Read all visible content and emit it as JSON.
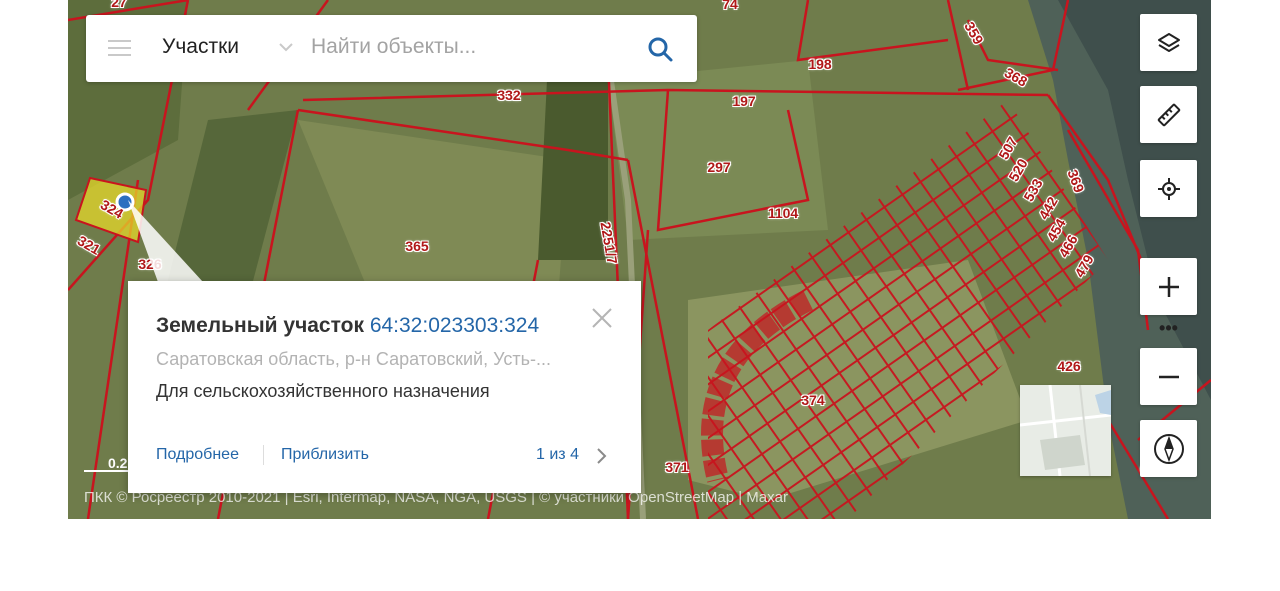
{
  "search": {
    "menu_icon": "hamburger-icon",
    "layer_label": "Участки",
    "placeholder": "Найти объекты...",
    "search_icon": "search-icon"
  },
  "map": {
    "parcel_labels": [
      "27",
      "74",
      "359",
      "198",
      "368",
      "332",
      "197",
      "507",
      "520",
      "297",
      "369",
      "533",
      "442",
      "1104",
      "454",
      "466",
      "2251/7",
      "479",
      "365",
      "321",
      "324",
      "326",
      "426",
      "374",
      "371",
      "67"
    ],
    "scale_label": "0.2",
    "attribution": "ПКК © Росреестр 2010-2021 | Esri, Intermap, NASA, NGA, USGS | © участники OpenStreetMap | Maxar",
    "boundary_color": "#c8141e",
    "selected_fill": "#e6d82a"
  },
  "controls": {
    "layers_icon": "layers-icon",
    "ruler_icon": "ruler-icon",
    "locate_icon": "locate-icon",
    "zoom_in_icon": "plus-icon",
    "more_label": "•••",
    "zoom_out_icon": "minus-icon",
    "compass_icon": "compass-icon"
  },
  "popup": {
    "title": "Земельный участок",
    "cadastral_number": "64:32:023303:324",
    "address": "Саратовская область, р-н Саратовский, Усть-...",
    "purpose": "Для сельскохозяйственного назначения",
    "details_link": "Подробнее",
    "zoom_link": "Приблизить",
    "pager": "1 из 4"
  }
}
